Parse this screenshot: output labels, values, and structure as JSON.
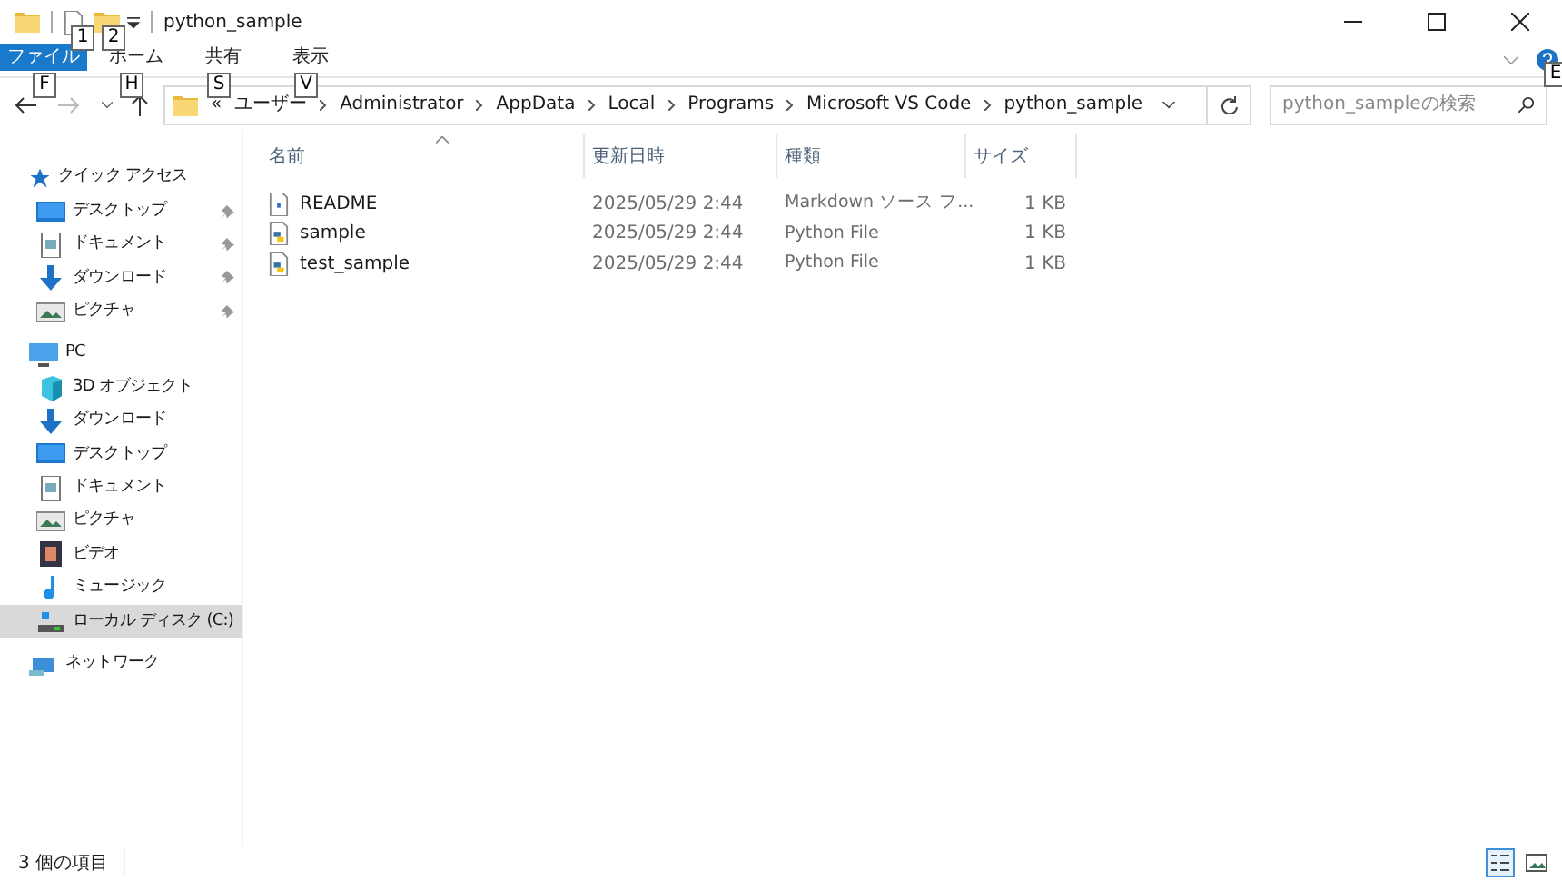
{
  "window": {
    "title": "python_sample",
    "quick_access_keys": [
      "1",
      "2"
    ]
  },
  "ribbon_tabs": [
    {
      "label": "ファイル",
      "selected": true,
      "key": "F"
    },
    {
      "label": "ホーム",
      "selected": false,
      "key": "H"
    },
    {
      "label": "共有",
      "selected": false,
      "key": "S"
    },
    {
      "label": "表示",
      "selected": false,
      "key": "V"
    }
  ],
  "help_key": "E",
  "address": {
    "overflow": "«",
    "segments": [
      "ユーザー",
      "Administrator",
      "AppData",
      "Local",
      "Programs",
      "Microsoft VS Code",
      "python_sample"
    ]
  },
  "search": {
    "placeholder": "python_sampleの検索"
  },
  "sidebar": {
    "items": [
      {
        "label": "クイック アクセス",
        "kind": "star",
        "selected": false,
        "children": [
          {
            "label": "デスクトップ",
            "kind": "desktop",
            "pinned": true,
            "selected": false
          },
          {
            "label": "ドキュメント",
            "kind": "document",
            "pinned": true,
            "selected": false
          },
          {
            "label": "ダウンロード",
            "kind": "download",
            "pinned": true,
            "selected": false
          },
          {
            "label": "ピクチャ",
            "kind": "picture",
            "pinned": true,
            "selected": false
          }
        ]
      },
      {
        "label": "PC",
        "kind": "pc",
        "selected": false,
        "children": [
          {
            "label": "3D オブジェクト",
            "kind": "cube",
            "pinned": false,
            "selected": false
          },
          {
            "label": "ダウンロード",
            "kind": "download",
            "pinned": false,
            "selected": false
          },
          {
            "label": "デスクトップ",
            "kind": "desktop",
            "pinned": false,
            "selected": false
          },
          {
            "label": "ドキュメント",
            "kind": "document",
            "pinned": false,
            "selected": false
          },
          {
            "label": "ピクチャ",
            "kind": "picture",
            "pinned": false,
            "selected": false
          },
          {
            "label": "ビデオ",
            "kind": "video",
            "pinned": false,
            "selected": false
          },
          {
            "label": "ミュージック",
            "kind": "music",
            "pinned": false,
            "selected": false
          },
          {
            "label": "ローカル ディスク (C:)",
            "kind": "disk",
            "pinned": false,
            "selected": true
          }
        ]
      },
      {
        "label": "ネットワーク",
        "kind": "network",
        "selected": false
      }
    ]
  },
  "table": {
    "columns": [
      "名前",
      "更新日時",
      "種類",
      "サイズ"
    ],
    "rows": [
      {
        "kind": "markdown",
        "name": "README",
        "modified": "2025/05/29 2:44",
        "type": "Markdown ソース フ...",
        "size": "1 KB"
      },
      {
        "kind": "python",
        "name": "sample",
        "modified": "2025/05/29 2:44",
        "type": "Python File",
        "size": "1 KB"
      },
      {
        "kind": "python",
        "name": "test_sample",
        "modified": "2025/05/29 2:44",
        "type": "Python File",
        "size": "1 KB"
      }
    ]
  },
  "status_bar": {
    "item_count": "3 個の項目",
    "view_buttons": [
      {
        "kind": "details",
        "selected": true
      },
      {
        "kind": "thumbnails",
        "selected": false
      }
    ]
  }
}
